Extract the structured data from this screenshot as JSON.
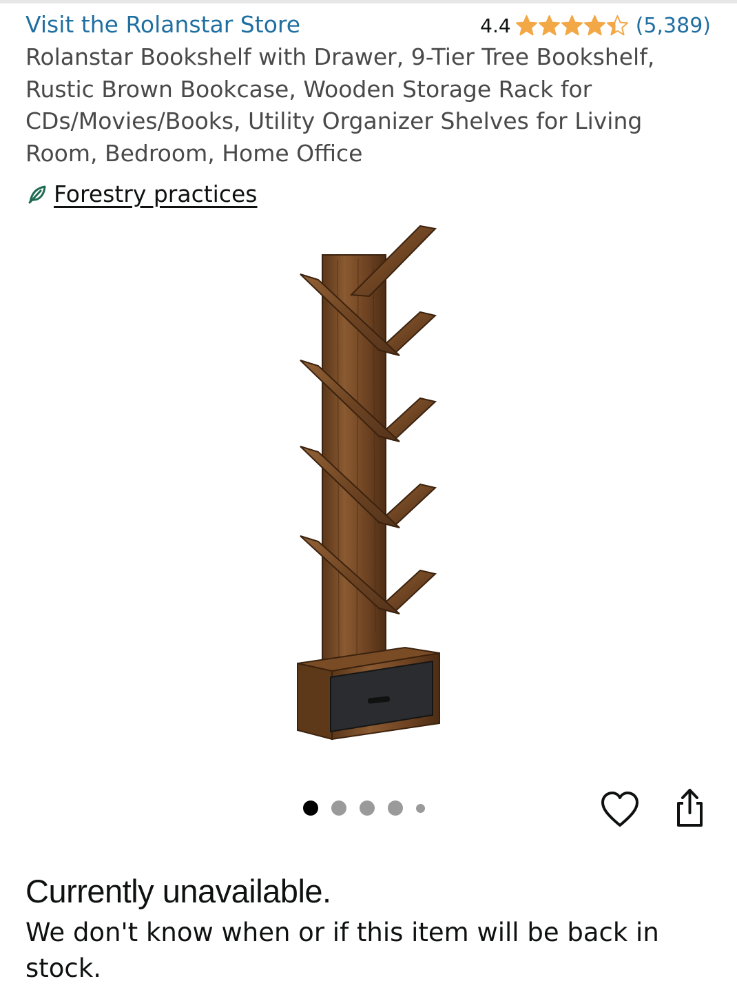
{
  "header": {
    "store_link": "Visit the Rolanstar Store",
    "rating_value": "4.4",
    "rating_stars": 4.4,
    "review_count": "(5,389)",
    "star_color": "#f3a847",
    "link_color": "#1f6fa1"
  },
  "product": {
    "title": "Rolanstar Bookshelf with Drawer, 9-Tier Tree Bookshelf, Rustic Brown Bookcase, Wooden Storage Rack for CDs/Movies/Books, Utility Organizer Shelves for Living Room, Bedroom, Home Office",
    "badge_icon": "leaf-icon",
    "badge_label": "Forestry practices",
    "image_alt": "tree-bookshelf-with-drawer"
  },
  "gallery": {
    "image_count": 5,
    "active_index": 0
  },
  "actions": {
    "wishlist_icon": "heart-icon",
    "share_icon": "share-icon"
  },
  "availability": {
    "heading": "Currently unavailable.",
    "message": "We don't know when or if this item will be back in stock."
  }
}
